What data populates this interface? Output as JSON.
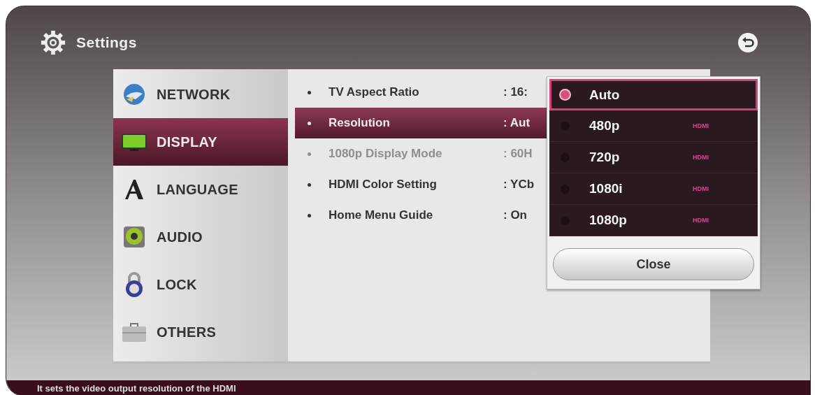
{
  "window": {
    "title": "Settings"
  },
  "sidebar": {
    "items": [
      {
        "kind": "network",
        "label": "NETWORK",
        "selected": false
      },
      {
        "kind": "display",
        "label": "DISPLAY",
        "selected": true
      },
      {
        "kind": "language",
        "label": "LANGUAGE",
        "selected": false
      },
      {
        "kind": "audio",
        "label": "AUDIO",
        "selected": false
      },
      {
        "kind": "lock",
        "label": "LOCK",
        "selected": false
      },
      {
        "kind": "others",
        "label": "OTHERS",
        "selected": false
      }
    ]
  },
  "settings": [
    {
      "label": "TV Aspect Ratio",
      "value": ": 16:",
      "selected": false,
      "disabled": false
    },
    {
      "label": "Resolution",
      "value": ": Aut",
      "selected": true,
      "disabled": false
    },
    {
      "label": "1080p Display Mode",
      "value": ": 60H",
      "selected": false,
      "disabled": true
    },
    {
      "label": "HDMI Color Setting",
      "value": ": YCb",
      "selected": false,
      "disabled": false
    },
    {
      "label": "Home Menu Guide",
      "value": ": On",
      "selected": false,
      "disabled": false
    }
  ],
  "popup": {
    "options": [
      {
        "label": "Auto",
        "selected": true
      },
      {
        "label": "480p",
        "badge": "HDMI",
        "selected": false
      },
      {
        "label": "720p",
        "badge": "HDMI",
        "selected": false
      },
      {
        "label": "1080i",
        "badge": "HDMI",
        "selected": false
      },
      {
        "label": "1080p",
        "badge": "HDMI",
        "selected": false
      }
    ],
    "close_button": "Close"
  },
  "status_bar": {
    "text": "It sets the video output resolution of the HDMI"
  }
}
